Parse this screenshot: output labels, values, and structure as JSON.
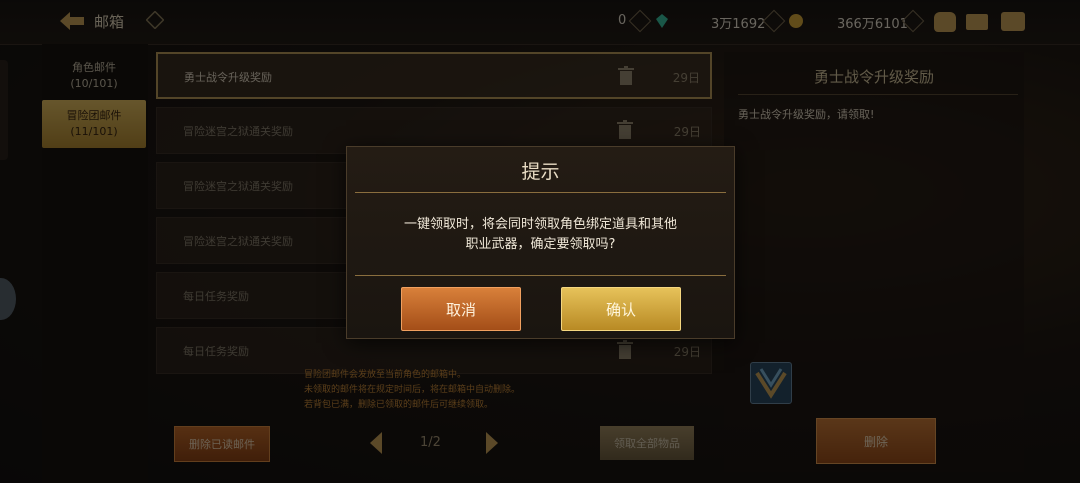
{
  "header": {
    "title": "邮箱",
    "gold_amount": "0",
    "gem_amount": "3万1692",
    "coin_amount": "366万6101"
  },
  "tabs": [
    {
      "label": "角色邮件",
      "count": "(10/101)"
    },
    {
      "label": "冒险团邮件",
      "count": "(11/101)"
    }
  ],
  "mail_list": [
    {
      "title": "勇士战令升级奖励",
      "days": "29日"
    },
    {
      "title": "冒险迷宫之狱通关奖励",
      "days": "29日"
    },
    {
      "title": "冒险迷宫之狱通关奖励",
      "days": ""
    },
    {
      "title": "冒险迷宫之狱通关奖励",
      "days": ""
    },
    {
      "title": "每日任务奖励",
      "days": ""
    },
    {
      "title": "每日任务奖励",
      "days": "29日"
    }
  ],
  "notes": [
    "冒险团邮件会发放至当前角色的邮箱中。",
    "未领取的邮件将在规定时间后，将在邮箱中自动删除。",
    "若背包已满，删除已领取的邮件后可继续领取。"
  ],
  "footer": {
    "delete_read_label": "删除已读邮件",
    "page": "1/2",
    "claim_all_label": "领取全部物品"
  },
  "detail": {
    "title": "勇士战令升级奖励",
    "body": "勇士战令升级奖励，请领取!",
    "delete_label": "删除"
  },
  "modal": {
    "title": "提示",
    "message_line1": "一键领取时，将会同时领取角色绑定道具和其他",
    "message_line2": "职业武器，确定要领取吗?",
    "cancel_label": "取消",
    "confirm_label": "确认"
  },
  "colors": {
    "accent_gold": "#c9a25a",
    "button_orange": "#c06a2a",
    "button_gold": "#e6c25a"
  }
}
